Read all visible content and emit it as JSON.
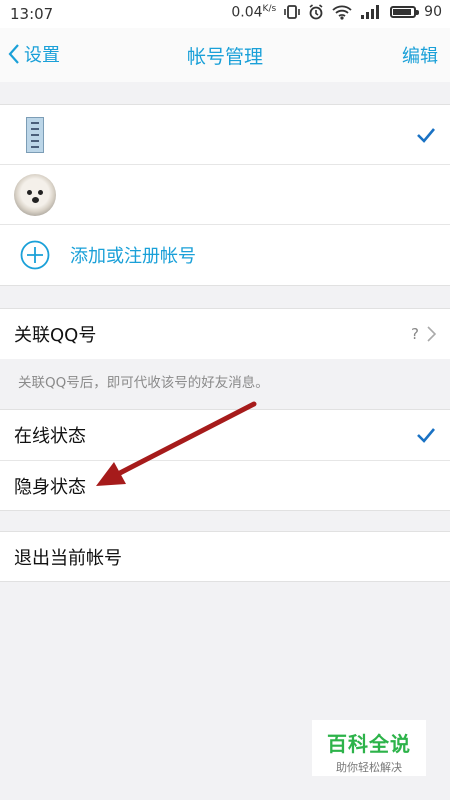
{
  "status_bar": {
    "time": "13:07",
    "net_speed": "0.04",
    "net_speed_unit": "K/s",
    "battery": "90",
    "battery_level": 0.9
  },
  "nav": {
    "back_label": "设置",
    "title": "帐号管理",
    "edit_label": "编辑"
  },
  "accounts": {
    "add_label": "添加或注册帐号"
  },
  "link_qq": {
    "label": "关联QQ号",
    "help": "?",
    "hint": "关联QQ号后，即可代收该号的好友消息。"
  },
  "status": {
    "online": "在线状态",
    "invisible": "隐身状态"
  },
  "logout": {
    "label": "退出当前帐号"
  },
  "watermark": {
    "title": "百科全说",
    "subtitle": "助你轻松解决"
  },
  "colors": {
    "accent": "#1aa0d8",
    "annotation_arrow": "#a61b1b",
    "watermark_green": "#2db34a"
  }
}
